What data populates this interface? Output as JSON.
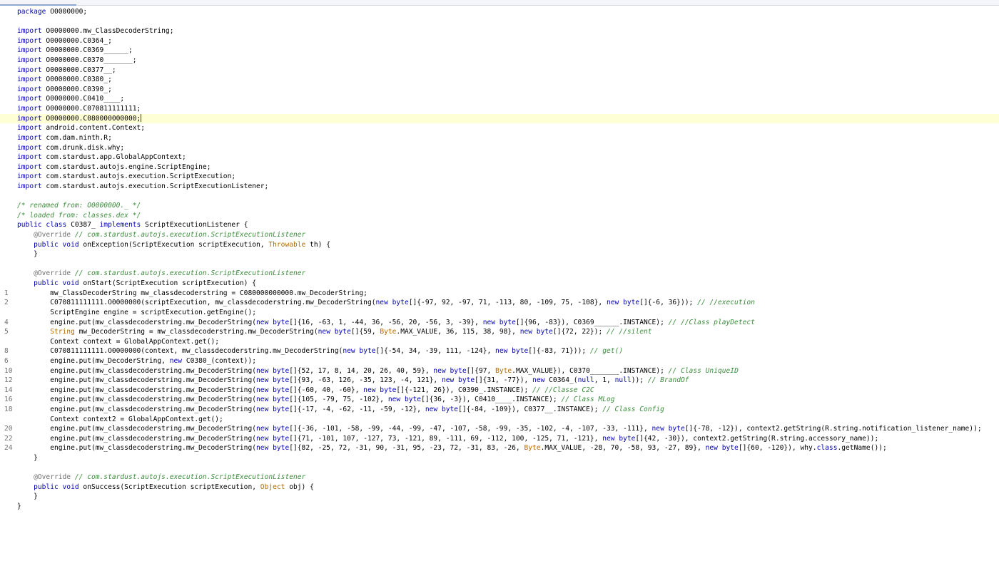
{
  "editor": {
    "accent_color": "#8ea8d2",
    "current_line_color": "#ffffd6",
    "token_colors": {
      "keyword": "#0000b3",
      "comment": "#3d8e3d",
      "annotation": "#707070",
      "type": "#b36b00",
      "plain": "#000000"
    },
    "current_line": 12,
    "lines": [
      {
        "gutter": "",
        "tokens": [
          [
            "keyword",
            "package"
          ],
          [
            "plain",
            " O0000000;"
          ]
        ]
      },
      {
        "gutter": "",
        "tokens": []
      },
      {
        "gutter": "",
        "tokens": [
          [
            "keyword",
            "import"
          ],
          [
            "plain",
            " O0000000.mw_ClassDecoderString;"
          ]
        ]
      },
      {
        "gutter": "",
        "tokens": [
          [
            "keyword",
            "import"
          ],
          [
            "plain",
            " O0000000.C0364_;"
          ]
        ]
      },
      {
        "gutter": "",
        "tokens": [
          [
            "keyword",
            "import"
          ],
          [
            "plain",
            " O0000000.C0369______;"
          ]
        ]
      },
      {
        "gutter": "",
        "tokens": [
          [
            "keyword",
            "import"
          ],
          [
            "plain",
            " O0000000.C0370_______;"
          ]
        ]
      },
      {
        "gutter": "",
        "tokens": [
          [
            "keyword",
            "import"
          ],
          [
            "plain",
            " O0000000.C0377__;"
          ]
        ]
      },
      {
        "gutter": "",
        "tokens": [
          [
            "keyword",
            "import"
          ],
          [
            "plain",
            " O0000000.C0380_;"
          ]
        ]
      },
      {
        "gutter": "",
        "tokens": [
          [
            "keyword",
            "import"
          ],
          [
            "plain",
            " O0000000.C0390_;"
          ]
        ]
      },
      {
        "gutter": "",
        "tokens": [
          [
            "keyword",
            "import"
          ],
          [
            "plain",
            " O0000000.C0410____;"
          ]
        ]
      },
      {
        "gutter": "",
        "tokens": [
          [
            "keyword",
            "import"
          ],
          [
            "plain",
            " O0000000.C070811111111;"
          ]
        ]
      },
      {
        "gutter": "",
        "tokens": [
          [
            "keyword",
            "import"
          ],
          [
            "plain",
            " O0000000.C080000000000;"
          ]
        ]
      },
      {
        "gutter": "",
        "tokens": [
          [
            "keyword",
            "import"
          ],
          [
            "plain",
            " android.content.Context;"
          ]
        ]
      },
      {
        "gutter": "",
        "tokens": [
          [
            "keyword",
            "import"
          ],
          [
            "plain",
            " com.dam.ninth.R;"
          ]
        ]
      },
      {
        "gutter": "",
        "tokens": [
          [
            "keyword",
            "import"
          ],
          [
            "plain",
            " com.drunk.disk.why;"
          ]
        ]
      },
      {
        "gutter": "",
        "tokens": [
          [
            "keyword",
            "import"
          ],
          [
            "plain",
            " com.stardust.app.GlobalAppContext;"
          ]
        ]
      },
      {
        "gutter": "",
        "tokens": [
          [
            "keyword",
            "import"
          ],
          [
            "plain",
            " com.stardust.autojs.engine.ScriptEngine;"
          ]
        ]
      },
      {
        "gutter": "",
        "tokens": [
          [
            "keyword",
            "import"
          ],
          [
            "plain",
            " com.stardust.autojs.execution.ScriptExecution;"
          ]
        ]
      },
      {
        "gutter": "",
        "tokens": [
          [
            "keyword",
            "import"
          ],
          [
            "plain",
            " com.stardust.autojs.execution.ScriptExecutionListener;"
          ]
        ]
      },
      {
        "gutter": "",
        "tokens": []
      },
      {
        "gutter": "",
        "tokens": [
          [
            "comment",
            "/* renamed from: O0000000._ */"
          ]
        ]
      },
      {
        "gutter": "",
        "tokens": [
          [
            "comment",
            "/* loaded from: classes.dex */"
          ]
        ]
      },
      {
        "gutter": "",
        "tokens": [
          [
            "keyword",
            "public class"
          ],
          [
            "plain",
            " C0387_ "
          ],
          [
            "keyword",
            "implements"
          ],
          [
            "plain",
            " ScriptExecutionListener {"
          ]
        ]
      },
      {
        "gutter": "",
        "tokens": [
          [
            "annotation",
            "    @Override"
          ],
          [
            "plain",
            " "
          ],
          [
            "comment",
            "// com.stardust.autojs.execution.ScriptExecutionListener"
          ]
        ]
      },
      {
        "gutter": "",
        "tokens": [
          [
            "keyword",
            "    public void"
          ],
          [
            "plain",
            " onException(ScriptExecution scriptExecution, "
          ],
          [
            "type",
            "Throwable"
          ],
          [
            "plain",
            " th) {"
          ]
        ]
      },
      {
        "gutter": "",
        "tokens": [
          [
            "plain",
            "    }"
          ]
        ]
      },
      {
        "gutter": "",
        "tokens": []
      },
      {
        "gutter": "",
        "tokens": [
          [
            "annotation",
            "    @Override"
          ],
          [
            "plain",
            " "
          ],
          [
            "comment",
            "// com.stardust.autojs.execution.ScriptExecutionListener"
          ]
        ]
      },
      {
        "gutter": "",
        "tokens": [
          [
            "keyword",
            "    public void"
          ],
          [
            "plain",
            " onStart(ScriptExecution scriptExecution) {"
          ]
        ]
      },
      {
        "gutter": "1",
        "tokens": [
          [
            "plain",
            "        mw_ClassDecoderString mw_classdecoderstring = C080000000000.mw_DecoderString;"
          ]
        ]
      },
      {
        "gutter": "2",
        "tokens": [
          [
            "plain",
            "        C070811111111.O0000000(scriptExecution, mw_classdecoderstring.mw_DecoderString("
          ],
          [
            "keyword",
            "new byte"
          ],
          [
            "plain",
            "[]{-97, 92, -97, 71, -113, 80, -109, 75, -108}, "
          ],
          [
            "keyword",
            "new byte"
          ],
          [
            "plain",
            "[]{-6, 36})); "
          ],
          [
            "comment",
            "// //execution"
          ]
        ]
      },
      {
        "gutter": "",
        "tokens": [
          [
            "plain",
            "        ScriptEngine engine = scriptExecution.getEngine();"
          ]
        ]
      },
      {
        "gutter": "4",
        "tokens": [
          [
            "plain",
            "        engine.put(mw_classdecoderstring.mw_DecoderString("
          ],
          [
            "keyword",
            "new byte"
          ],
          [
            "plain",
            "[]{16, -63, 1, -44, 36, -56, 20, -56, 3, -39}, "
          ],
          [
            "keyword",
            "new byte"
          ],
          [
            "plain",
            "[]{96, -83}), C0369______.INSTANCE); "
          ],
          [
            "comment",
            "// //Class playDetect"
          ]
        ]
      },
      {
        "gutter": "5",
        "tokens": [
          [
            "type",
            "        String"
          ],
          [
            "plain",
            " mw_DecoderString = mw_classdecoderstring.mw_DecoderString("
          ],
          [
            "keyword",
            "new byte"
          ],
          [
            "plain",
            "[]{59, "
          ],
          [
            "type",
            "Byte"
          ],
          [
            "plain",
            ".MAX_VALUE, 36, 115, 38, 98}, "
          ],
          [
            "keyword",
            "new byte"
          ],
          [
            "plain",
            "[]{72, 22}); "
          ],
          [
            "comment",
            "// //silent"
          ]
        ]
      },
      {
        "gutter": "",
        "tokens": [
          [
            "plain",
            "        Context context = GlobalAppContext.get();"
          ]
        ]
      },
      {
        "gutter": "8",
        "tokens": [
          [
            "plain",
            "        C070811111111.O0000000(context, mw_classdecoderstring.mw_DecoderString("
          ],
          [
            "keyword",
            "new byte"
          ],
          [
            "plain",
            "[]{-54, 34, -39, 111, -124}, "
          ],
          [
            "keyword",
            "new byte"
          ],
          [
            "plain",
            "[]{-83, 71})); "
          ],
          [
            "comment",
            "// get()"
          ]
        ]
      },
      {
        "gutter": "6",
        "tokens": [
          [
            "plain",
            "        engine.put(mw_DecoderString, "
          ],
          [
            "keyword",
            "new"
          ],
          [
            "plain",
            " C0380_(context));"
          ]
        ]
      },
      {
        "gutter": "10",
        "tokens": [
          [
            "plain",
            "        engine.put(mw_classdecoderstring.mw_DecoderString("
          ],
          [
            "keyword",
            "new byte"
          ],
          [
            "plain",
            "[]{52, 17, 8, 14, 20, 26, 40, 59}, "
          ],
          [
            "keyword",
            "new byte"
          ],
          [
            "plain",
            "[]{97, "
          ],
          [
            "type",
            "Byte"
          ],
          [
            "plain",
            ".MAX_VALUE}), C0370_______.INSTANCE); "
          ],
          [
            "comment",
            "// Class UniqueID"
          ]
        ]
      },
      {
        "gutter": "12",
        "tokens": [
          [
            "plain",
            "        engine.put(mw_classdecoderstring.mw_DecoderString("
          ],
          [
            "keyword",
            "new byte"
          ],
          [
            "plain",
            "[]{93, -63, 126, -35, 123, -4, 121}, "
          ],
          [
            "keyword",
            "new byte"
          ],
          [
            "plain",
            "[]{31, -77}), "
          ],
          [
            "keyword",
            "new"
          ],
          [
            "plain",
            " C0364_("
          ],
          [
            "keyword",
            "null"
          ],
          [
            "plain",
            ", 1, "
          ],
          [
            "keyword",
            "null"
          ],
          [
            "plain",
            ")); "
          ],
          [
            "comment",
            "// BrandOf"
          ]
        ]
      },
      {
        "gutter": "14",
        "tokens": [
          [
            "plain",
            "        engine.put(mw_classdecoderstring.mw_DecoderString("
          ],
          [
            "keyword",
            "new byte"
          ],
          [
            "plain",
            "[]{-60, 40, -60}, "
          ],
          [
            "keyword",
            "new byte"
          ],
          [
            "plain",
            "[]{-121, 26}), C0390_.INSTANCE); "
          ],
          [
            "comment",
            "// //Classe C2C"
          ]
        ]
      },
      {
        "gutter": "16",
        "tokens": [
          [
            "plain",
            "        engine.put(mw_classdecoderstring.mw_DecoderString("
          ],
          [
            "keyword",
            "new byte"
          ],
          [
            "plain",
            "[]{105, -79, 75, -102}, "
          ],
          [
            "keyword",
            "new byte"
          ],
          [
            "plain",
            "[]{36, -3}), C0410____.INSTANCE); "
          ],
          [
            "comment",
            "// Class MLog"
          ]
        ]
      },
      {
        "gutter": "18",
        "tokens": [
          [
            "plain",
            "        engine.put(mw_classdecoderstring.mw_DecoderString("
          ],
          [
            "keyword",
            "new byte"
          ],
          [
            "plain",
            "[]{-17, -4, -62, -11, -59, -12}, "
          ],
          [
            "keyword",
            "new byte"
          ],
          [
            "plain",
            "[]{-84, -109}), C0377__.INSTANCE); "
          ],
          [
            "comment",
            "// Class Config"
          ]
        ]
      },
      {
        "gutter": "",
        "tokens": [
          [
            "plain",
            "        Context context2 = GlobalAppContext.get();"
          ]
        ]
      },
      {
        "gutter": "20",
        "tokens": [
          [
            "plain",
            "        engine.put(mw_classdecoderstring.mw_DecoderString("
          ],
          [
            "keyword",
            "new byte"
          ],
          [
            "plain",
            "[]{-36, -101, -58, -99, -44, -99, -47, -107, -58, -99, -35, -102, -4, -107, -33, -111}, "
          ],
          [
            "keyword",
            "new byte"
          ],
          [
            "plain",
            "[]{-78, -12}), context2.getString(R.string.notification_listener_name));"
          ]
        ]
      },
      {
        "gutter": "22",
        "tokens": [
          [
            "plain",
            "        engine.put(mw_classdecoderstring.mw_DecoderString("
          ],
          [
            "keyword",
            "new byte"
          ],
          [
            "plain",
            "[]{71, -101, 107, -127, 73, -121, 89, -111, 69, -112, 100, -125, 71, -121}, "
          ],
          [
            "keyword",
            "new byte"
          ],
          [
            "plain",
            "[]{42, -30}), context2.getString(R.string.accessory_name));"
          ]
        ]
      },
      {
        "gutter": "24",
        "tokens": [
          [
            "plain",
            "        engine.put(mw_classdecoderstring.mw_DecoderString("
          ],
          [
            "keyword",
            "new byte"
          ],
          [
            "plain",
            "[]{82, -25, 72, -31, 90, -31, 95, -23, 72, -31, 83, -26, "
          ],
          [
            "type",
            "Byte"
          ],
          [
            "plain",
            ".MAX_VALUE, -28, 70, -58, 93, -27, 89}, "
          ],
          [
            "keyword",
            "new byte"
          ],
          [
            "plain",
            "[]{60, -120}), why."
          ],
          [
            "keyword",
            "class"
          ],
          [
            "plain",
            ".getName());"
          ]
        ]
      },
      {
        "gutter": "",
        "tokens": [
          [
            "plain",
            "    }"
          ]
        ]
      },
      {
        "gutter": "",
        "tokens": []
      },
      {
        "gutter": "",
        "tokens": [
          [
            "annotation",
            "    @Override"
          ],
          [
            "plain",
            " "
          ],
          [
            "comment",
            "// com.stardust.autojs.execution.ScriptExecutionListener"
          ]
        ]
      },
      {
        "gutter": "",
        "tokens": [
          [
            "keyword",
            "    public void"
          ],
          [
            "plain",
            " onSuccess(ScriptExecution scriptExecution, "
          ],
          [
            "type",
            "Object"
          ],
          [
            "plain",
            " obj) {"
          ]
        ]
      },
      {
        "gutter": "",
        "tokens": [
          [
            "plain",
            "    }"
          ]
        ]
      },
      {
        "gutter": "",
        "tokens": [
          [
            "plain",
            "}"
          ]
        ]
      }
    ]
  }
}
